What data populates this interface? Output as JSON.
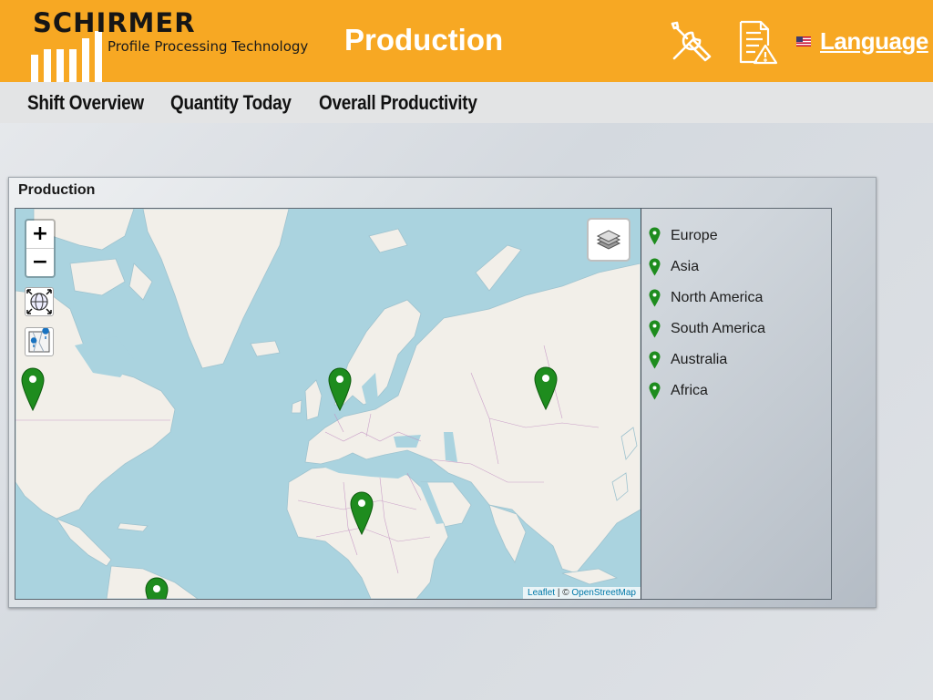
{
  "header": {
    "brand": "SCHIRMER",
    "tagline": "Profile Processing Technology",
    "title": "Production",
    "language_label": "Language",
    "accent_color": "#f7a823",
    "icons": [
      "tools-icon",
      "document-warning-icon",
      "us-flag-icon"
    ]
  },
  "nav": {
    "items": [
      {
        "label": "Shift Overview"
      },
      {
        "label": "Quantity Today"
      },
      {
        "label": "Overall Productivity"
      }
    ]
  },
  "panel": {
    "title": "Production",
    "map": {
      "zoom_in": "+",
      "zoom_out": "−",
      "attribution_leaflet": "Leaflet",
      "attribution_sep": " | © ",
      "attribution_osm": "OpenStreetMap",
      "marker_color": "#1e8c1e"
    },
    "legend": {
      "items": [
        {
          "label": "Europe"
        },
        {
          "label": "Asia"
        },
        {
          "label": "North America"
        },
        {
          "label": "South America"
        },
        {
          "label": "Australia"
        },
        {
          "label": "Africa"
        }
      ]
    }
  }
}
